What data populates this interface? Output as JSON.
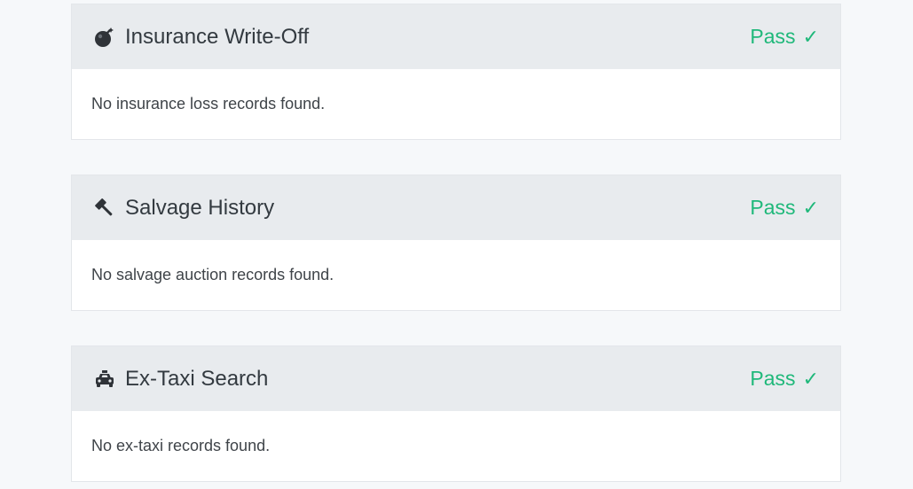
{
  "checks": [
    {
      "icon": "bomb-icon",
      "title": "Insurance Write-Off",
      "status": "Pass",
      "status_icon": "checkmark-icon",
      "message": "No insurance loss records found."
    },
    {
      "icon": "gavel-icon",
      "title": "Salvage History",
      "status": "Pass",
      "status_icon": "checkmark-icon",
      "message": "No salvage auction records found."
    },
    {
      "icon": "taxi-icon",
      "title": "Ex-Taxi Search",
      "status": "Pass",
      "status_icon": "checkmark-icon",
      "message": "No ex-taxi records found."
    }
  ],
  "colors": {
    "pass": "#1fb87a",
    "header_bg": "#e8ebee",
    "page_bg": "#f6f8fa"
  }
}
